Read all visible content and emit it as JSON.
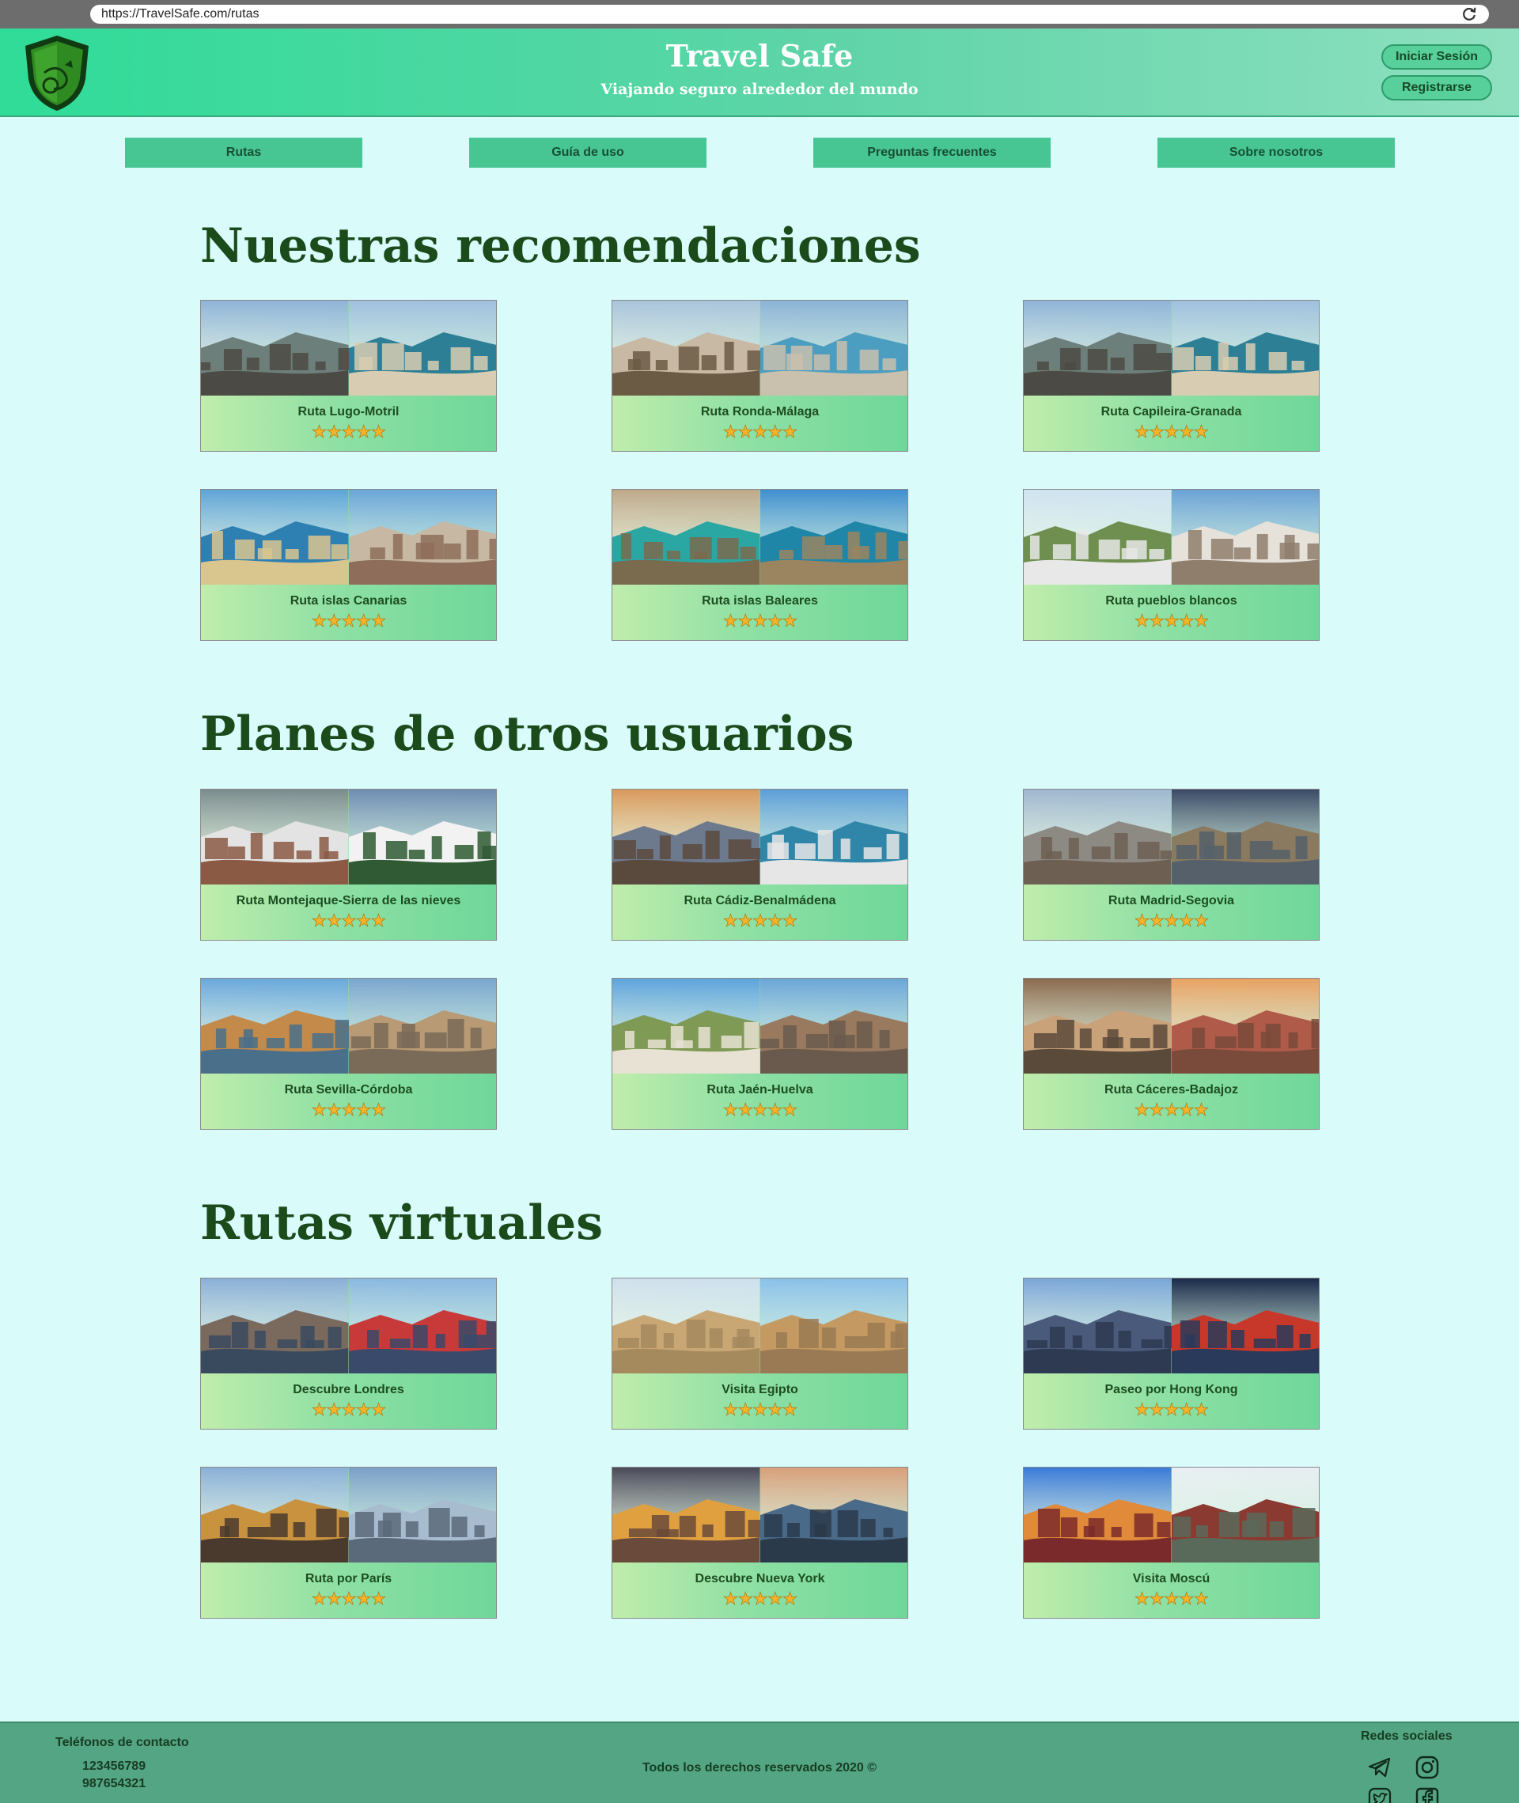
{
  "browser": {
    "url": "https://TravelSafe.com/rutas"
  },
  "header": {
    "title": "Travel Safe",
    "subtitle": "Viajando seguro alrededor del mundo",
    "login_label": "Iniciar Sesión",
    "register_label": "Registrarse"
  },
  "nav": {
    "items": [
      "Rutas",
      "Guía de uso",
      "Preguntas frecuentes",
      "Sobre nosotros"
    ]
  },
  "sections": [
    {
      "title": "Nuestras recomendaciones",
      "cards": [
        {
          "title": "Ruta Lugo-Motril",
          "rating": 5
        },
        {
          "title": "Ruta Ronda-Málaga",
          "rating": 5
        },
        {
          "title": "Ruta Capileira-Granada",
          "rating": 5
        },
        {
          "title": "Ruta islas Canarias",
          "rating": 5
        },
        {
          "title": "Ruta islas Baleares",
          "rating": 5
        },
        {
          "title": "Ruta pueblos blancos",
          "rating": 5
        }
      ]
    },
    {
      "title": "Planes de otros usuarios",
      "cards": [
        {
          "title": "Ruta Montejaque-Sierra de las nieves",
          "rating": 5
        },
        {
          "title": "Ruta Cádiz-Benalmádena",
          "rating": 5
        },
        {
          "title": "Ruta Madrid-Segovia",
          "rating": 5
        },
        {
          "title": "Ruta Sevilla-Córdoba",
          "rating": 5
        },
        {
          "title": "Ruta Jaén-Huelva",
          "rating": 5
        },
        {
          "title": "Ruta Cáceres-Badajoz",
          "rating": 5
        }
      ]
    },
    {
      "title": "Rutas virtuales",
      "cards": [
        {
          "title": "Descubre Londres",
          "rating": 5
        },
        {
          "title": "Visita Egipto",
          "rating": 5
        },
        {
          "title": "Paseo por Hong Kong",
          "rating": 5
        },
        {
          "title": "Ruta por París",
          "rating": 5
        },
        {
          "title": "Descubre Nueva York",
          "rating": 5
        },
        {
          "title": "Visita Moscú",
          "rating": 5
        }
      ]
    }
  ],
  "footer": {
    "contact_label": "Teléfonos de contacto",
    "phones": [
      "123456789",
      "987654321"
    ],
    "rights": "Todos los derechos reservados 2020 ©",
    "social_label": "Redes sociales",
    "social_icons": [
      "telegram-icon",
      "instagram-icon",
      "twitter-icon",
      "facebook-icon"
    ]
  },
  "colors": {
    "background": "#d9fcfb",
    "accent": "#47c694",
    "title": "#1b4a1b",
    "star": "#f5b32a"
  }
}
